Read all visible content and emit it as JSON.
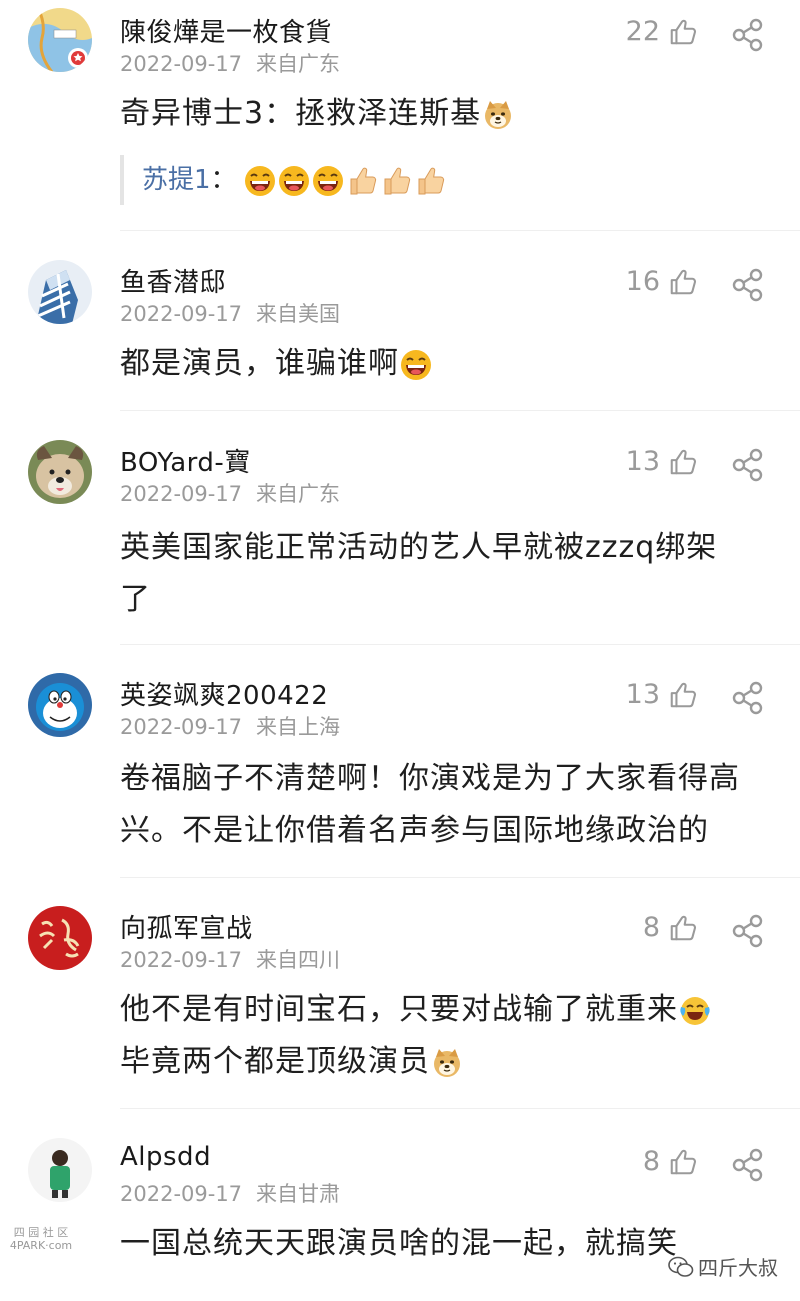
{
  "comments": [
    {
      "username": "陳俊燁是一枚食貨",
      "date": "2022-09-17",
      "location": "来自广东",
      "likes": "22",
      "text": "奇异博士3：拯救泽连斯基",
      "emojis": [
        "doge-emoji"
      ],
      "reply": {
        "name": "苏提1",
        "colon": "：",
        "emojis": [
          "laugh-emoji",
          "laugh-emoji",
          "laugh-emoji",
          "thumbs-up-emoji",
          "thumbs-up-emoji",
          "thumbs-up-emoji"
        ]
      }
    },
    {
      "username": "鱼香潜邸",
      "date": "2022-09-17",
      "location": "来自美国",
      "likes": "16",
      "text": "都是演员，谁骗谁啊",
      "emojis": [
        "laugh-emoji"
      ]
    },
    {
      "username": "BOYard-寶",
      "date": "2022-09-17",
      "location": "来自广东",
      "likes": "13",
      "line1": "英美国家能正常活动的艺人早就被zzzq绑架",
      "line2": "了"
    },
    {
      "username": "英姿飒爽200422",
      "date": "2022-09-17",
      "location": "来自上海",
      "likes": "13",
      "line1": "卷福脑子不清楚啊！你演戏是为了大家看得高",
      "line2": "兴。不是让你借着名声参与国际地缘政治的"
    },
    {
      "username": "向孤军宣战",
      "date": "2022-09-17",
      "location": "来自四川",
      "likes": "8",
      "line1": "他不是有时间宝石，只要对战输了就重来",
      "line1_emojis": [
        "cry-laugh-emoji"
      ],
      "line2": "毕竟两个都是顶级演员",
      "line2_emojis": [
        "doge-emoji"
      ]
    },
    {
      "username": "Alpsdd",
      "date": "2022-09-17",
      "location": "来自甘肃",
      "likes": "8",
      "text": "一国总统天天跟演员啥的混一起，就搞笑"
    }
  ],
  "watermark_left": {
    "line1": "四 园 社 区",
    "line2": "4PARK·com"
  },
  "watermark_right": {
    "text": "四斤大叔",
    "icon": "wechat-icon"
  },
  "colors": {
    "meta_gray": "#9a9a9a",
    "reply_name_blue": "#4a6fa5",
    "text": "#1f1f1f"
  }
}
